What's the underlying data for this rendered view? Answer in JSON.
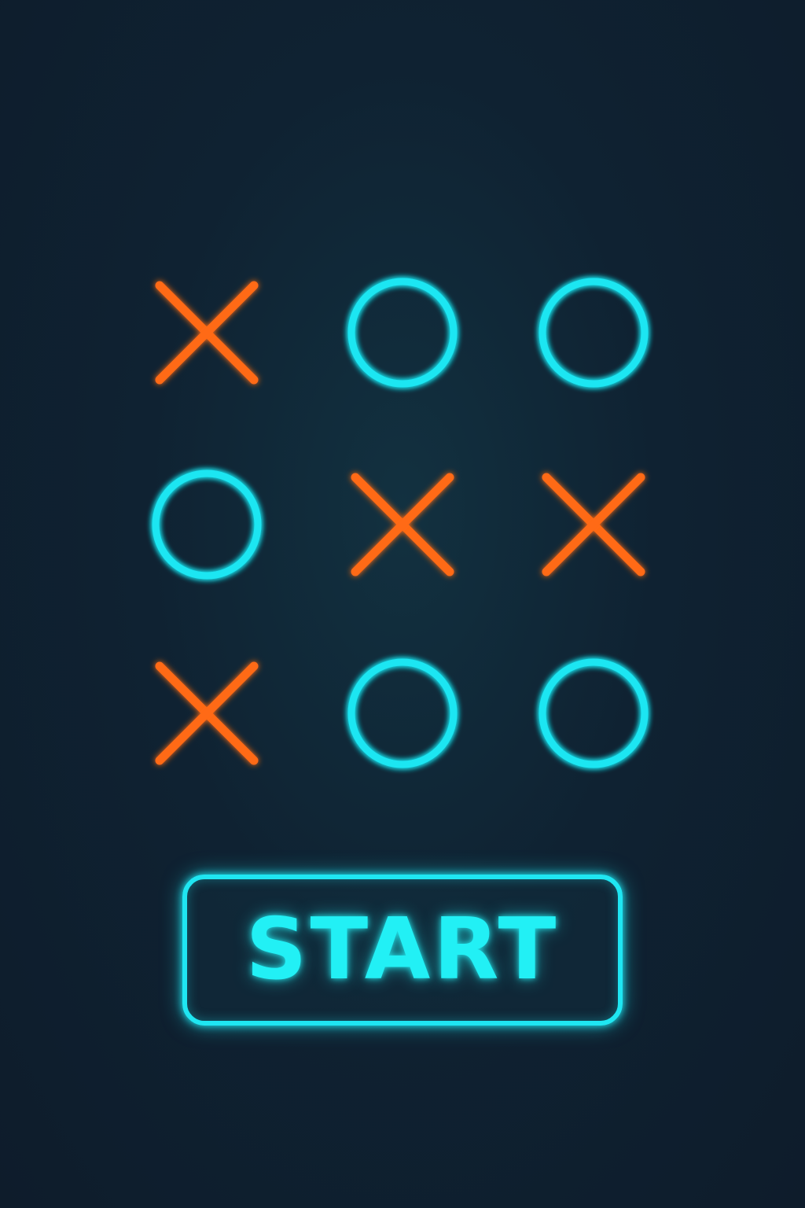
{
  "colors": {
    "background": "#0f1d2c",
    "grid": "#1fe6f2",
    "o_mark": "#1fe6f2",
    "x_mark": "#ff6a12"
  },
  "board": {
    "cells": [
      [
        "X",
        "O",
        "O"
      ],
      [
        "O",
        "X",
        "X"
      ],
      [
        "X",
        "O",
        "O"
      ]
    ]
  },
  "start_button": {
    "label": "START"
  }
}
